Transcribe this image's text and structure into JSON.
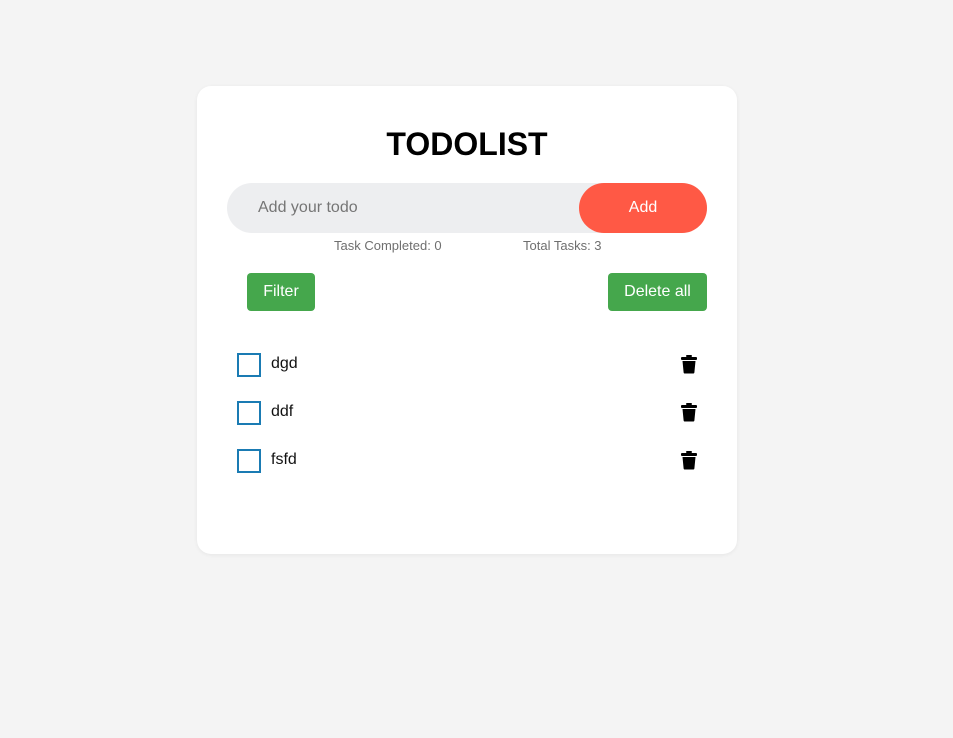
{
  "app": {
    "title": "TODOLIST"
  },
  "input": {
    "placeholder": "Add your todo",
    "value": ""
  },
  "buttons": {
    "add_label": "Add",
    "filter_label": "Filter",
    "delete_all_label": "Delete all"
  },
  "stats": {
    "completed_text": "Task Completed: 0",
    "total_text": "Total Tasks: 3"
  },
  "todos": [
    {
      "text": "dgd",
      "completed": false
    },
    {
      "text": "ddf",
      "completed": false
    },
    {
      "text": "fsfd",
      "completed": false
    }
  ],
  "icons": {
    "delete": "trash-icon"
  },
  "colors": {
    "background": "#f4f4f4",
    "card": "#ffffff",
    "add_button": "#ff5945",
    "action_button": "#45a74c",
    "checkbox_border": "#1a7bb3",
    "input_background": "#edeef0"
  }
}
